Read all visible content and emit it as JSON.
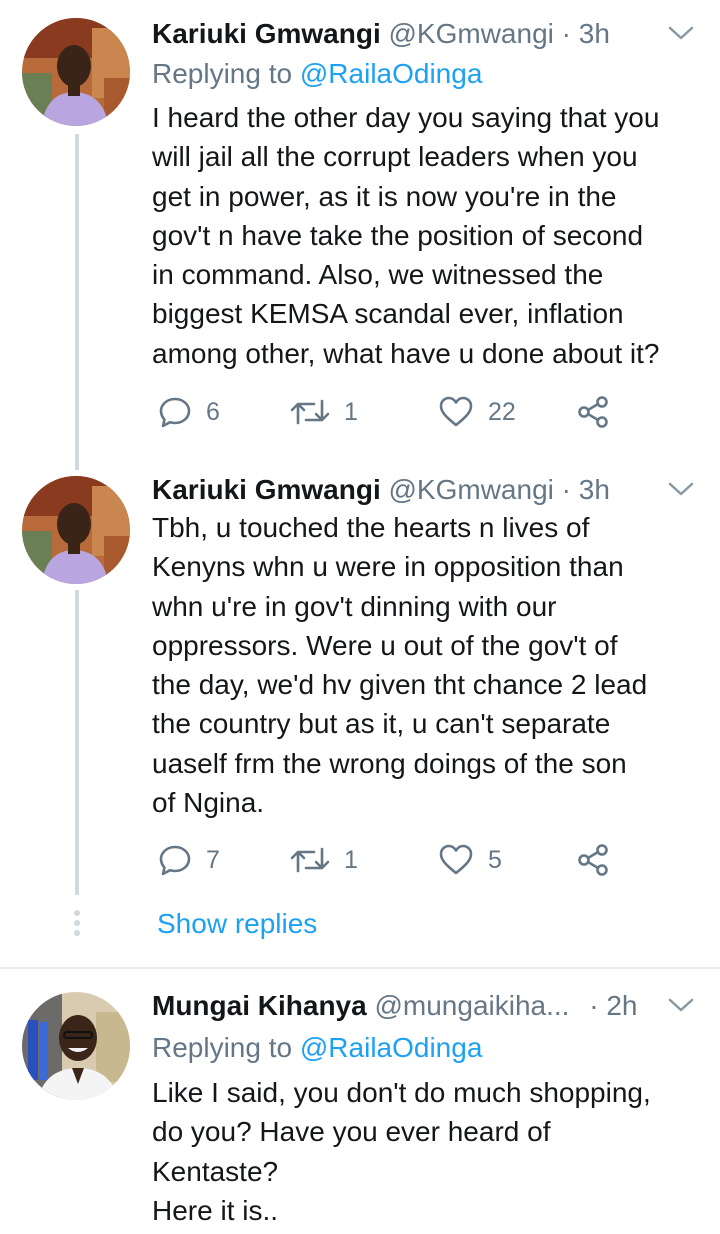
{
  "tweets": [
    {
      "name": "Kariuki Gmwangi",
      "handle": "@KGmwangi",
      "time": "3h",
      "reply_prefix": "Replying to",
      "reply_mention": "@RailaOdinga",
      "lines": [
        "I heard the other day you saying that you",
        "will jail all the corrupt leaders when you",
        "get in power, as it is now you're in the",
        "gov't n have take the position of second",
        "in command. Also, we witnessed the",
        "biggest KEMSA scandal ever, inflation",
        "among other, what have u done about it?"
      ],
      "replies": "6",
      "retweets": "1",
      "likes": "22"
    },
    {
      "name": "Kariuki Gmwangi",
      "handle": "@KGmwangi",
      "time": "3h",
      "lines": [
        "Tbh, u touched the hearts n lives of",
        "Kenyns whn u were in opposition than",
        "whn u're in gov't dinning with our",
        "oppressors. Were u  out of the gov't of",
        "the day, we'd hv given tht chance 2 lead",
        "the country but as it, u can't separate",
        "uaself frm the wrong doings of the son",
        "of Ngina."
      ],
      "replies": "7",
      "retweets": "1",
      "likes": "5"
    },
    {
      "name": "Mungai Kihanya",
      "handle": "@mungaikiha...",
      "time": "2h",
      "reply_prefix": "Replying to",
      "reply_mention": "@RailaOdinga",
      "lines": [
        "Like I said, you don't do much shopping,",
        "do you? Have you ever heard of",
        "Kentaste?",
        "Here it is.."
      ]
    }
  ],
  "show_replies": "Show replies",
  "separator": "·",
  "colors": {
    "accent": "#1da1f2",
    "muted": "#657786",
    "line": "#cfd9de"
  }
}
